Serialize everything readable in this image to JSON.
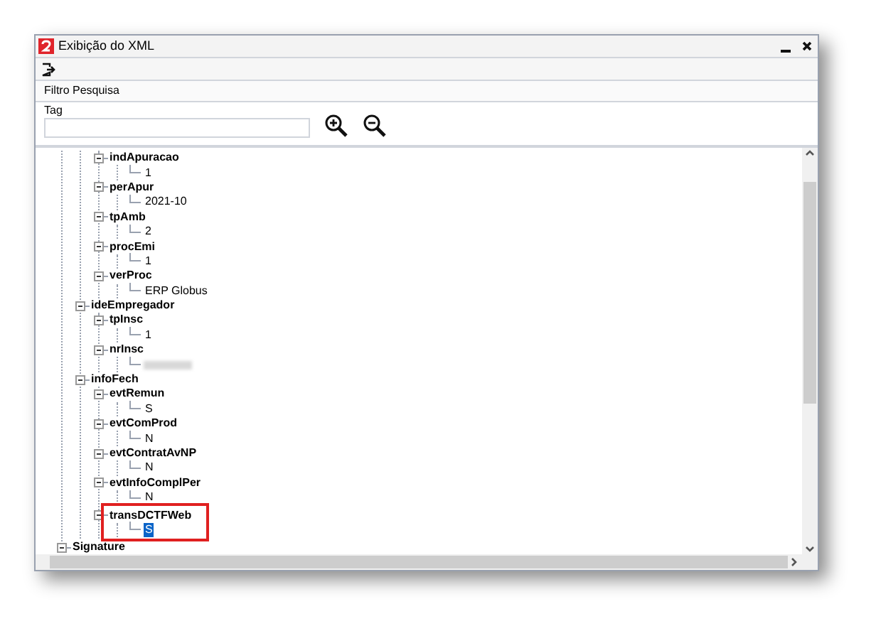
{
  "window": {
    "title": "Exibição do XML"
  },
  "filter": {
    "section_title": "Filtro Pesquisa",
    "label": "Tag"
  },
  "tree": [
    {
      "children": [
        {
          "children": [
            {
              "tag": "indApuracao",
              "children": [
                {
                  "kind": "value",
                  "value": "1",
                  "selected": false
                }
              ]
            },
            {
              "tag": "perApur",
              "children": [
                {
                  "kind": "value",
                  "value": "2021-10",
                  "selected": false
                }
              ]
            },
            {
              "tag": "tpAmb",
              "children": [
                {
                  "kind": "value",
                  "value": "2",
                  "selected": false
                }
              ]
            },
            {
              "tag": "procEmi",
              "children": [
                {
                  "kind": "value",
                  "value": "1",
                  "selected": false
                }
              ]
            },
            {
              "tag": "verProc",
              "children": [
                {
                  "kind": "value",
                  "value": "ERP Globus",
                  "selected": false
                }
              ]
            }
          ]
        },
        {
          "tag": "ideEmpregador",
          "children": [
            {
              "tag": "tpInsc",
              "children": [
                {
                  "kind": "value",
                  "value": "1",
                  "selected": false
                }
              ]
            },
            {
              "tag": "nrInsc",
              "children": [
                {
                  "kind": "redacted"
                }
              ]
            }
          ]
        },
        {
          "tag": "infoFech",
          "children": [
            {
              "tag": "evtRemun",
              "children": [
                {
                  "kind": "value",
                  "value": "S",
                  "selected": false
                }
              ]
            },
            {
              "tag": "evtComProd",
              "children": [
                {
                  "kind": "value",
                  "value": "N",
                  "selected": false
                }
              ]
            },
            {
              "tag": "evtContratAvNP",
              "children": [
                {
                  "kind": "value",
                  "value": "N",
                  "selected": false
                }
              ]
            },
            {
              "tag": "evtInfoComplPer",
              "children": [
                {
                  "kind": "value",
                  "value": "N",
                  "selected": false
                }
              ]
            },
            {
              "tag": "transDCTFWeb",
              "highlighted": true,
              "children": [
                {
                  "kind": "value",
                  "value": "S",
                  "selected": true
                }
              ]
            }
          ]
        }
      ]
    },
    {
      "tag": "Signature"
    }
  ]
}
